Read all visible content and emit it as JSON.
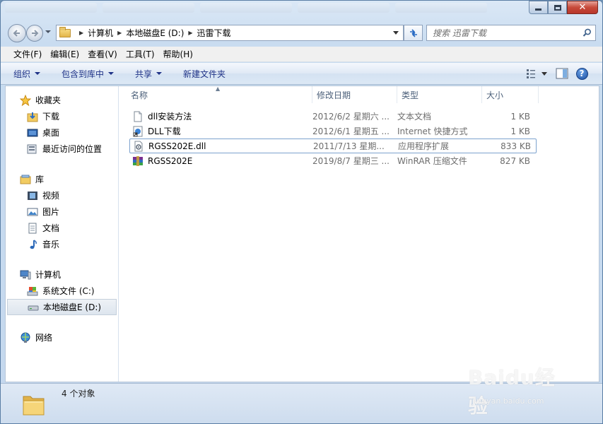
{
  "window": {
    "breadcrumbs": [
      "计算机",
      "本地磁盘E (D:)",
      "迅雷下载"
    ],
    "search_placeholder": "搜索 迅雷下载"
  },
  "menu": [
    "文件(F)",
    "编辑(E)",
    "查看(V)",
    "工具(T)",
    "帮助(H)"
  ],
  "commands": {
    "organize": "组织",
    "include_in_library": "包含到库中",
    "share": "共享",
    "new_folder": "新建文件夹"
  },
  "navpane": {
    "favorites": {
      "label": "收藏夹",
      "items": [
        "下载",
        "桌面",
        "最近访问的位置"
      ]
    },
    "libraries": {
      "label": "库",
      "items": [
        "视频",
        "图片",
        "文档",
        "音乐"
      ]
    },
    "computer": {
      "label": "计算机",
      "items": [
        "系统文件 (C:)",
        "本地磁盘E (D:)"
      ],
      "selected": "本地磁盘E (D:)"
    },
    "network": {
      "label": "网络"
    }
  },
  "columns": {
    "name": "名称",
    "date": "修改日期",
    "type": "类型",
    "size": "大小"
  },
  "files": [
    {
      "name": "dll安装方法",
      "date": "2012/6/2 星期六 ...",
      "type": "文本文档",
      "size": "1 KB",
      "icon": "text-document-icon"
    },
    {
      "name": "DLL下载",
      "date": "2012/6/1 星期五 ...",
      "type": "Internet 快捷方式",
      "size": "1 KB",
      "icon": "internet-shortcut-icon"
    },
    {
      "name": "RGSS202E.dll",
      "date": "2011/7/13 星期...",
      "type": "应用程序扩展",
      "size": "833 KB",
      "icon": "dll-file-icon",
      "focused": true
    },
    {
      "name": "RGSS202E",
      "date": "2019/8/7 星期三 ...",
      "type": "WinRAR 压缩文件",
      "size": "827 KB",
      "icon": "winrar-archive-icon"
    }
  ],
  "details": {
    "count": "4 个对象"
  },
  "watermark": {
    "logo": "Baidu经验",
    "url": "jingyan.baidu.com"
  },
  "colors": {
    "command_text": "#1e3287",
    "secondary_text": "#6d6d6d",
    "header_text": "#4c607a"
  }
}
